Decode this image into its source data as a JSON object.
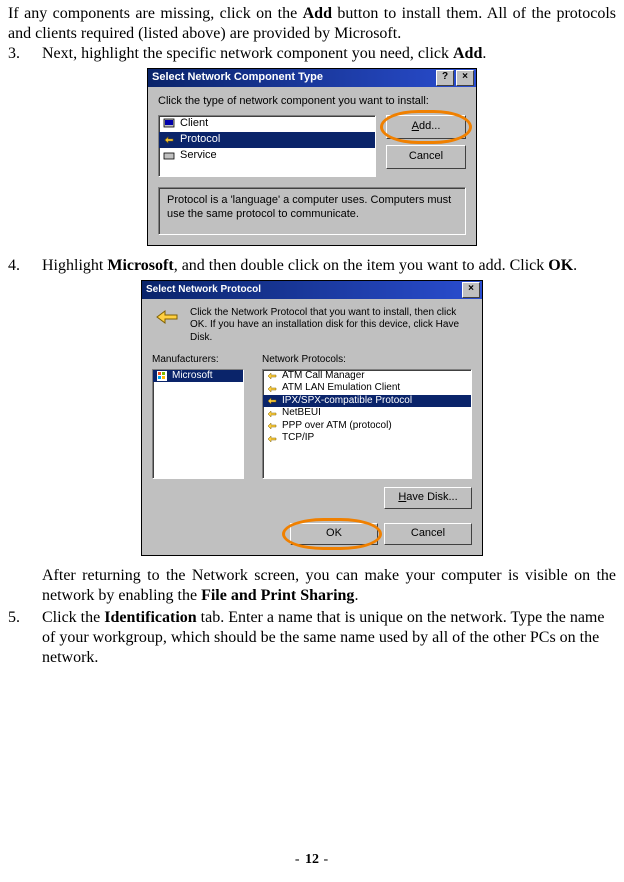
{
  "intro": {
    "para1_a": "If any components are missing, click on the ",
    "para1_add": "Add",
    "para1_b": " button to install them. All of the protocols and clients required (listed above) are provided by Microsoft."
  },
  "step3": {
    "num": "3.",
    "text_a": "Next, highlight the specific network component you need, click ",
    "text_add": "Add",
    "text_b": "."
  },
  "dlg1": {
    "title": "Select Network Component Type",
    "help_glyph": "?",
    "close_glyph": "×",
    "instr": "Click the type of network component you want to install:",
    "items": [
      "Client",
      "Protocol",
      "Service"
    ],
    "selected_index": 1,
    "btn_add": "Add...",
    "btn_cancel": "Cancel",
    "desc": "Protocol is a 'language' a computer uses. Computers must use the same protocol to communicate."
  },
  "step4": {
    "num": "4.",
    "text_a": "Highlight ",
    "text_ms": "Microsoft",
    "text_b": ", and then double click on the item you want to add. Click ",
    "text_ok": "OK",
    "text_c": "."
  },
  "dlg2": {
    "title": "Select Network Protocol",
    "close_glyph": "×",
    "instr": "Click the Network Protocol that you want to install, then click OK. If you have an installation disk for this device, click Have Disk.",
    "mfg_label": "Manufacturers:",
    "proto_label": "Network Protocols:",
    "mfg_items": [
      "Microsoft"
    ],
    "mfg_selected_index": 0,
    "proto_items": [
      "ATM Call Manager",
      "ATM LAN Emulation Client",
      "IPX/SPX-compatible Protocol",
      "NetBEUI",
      "PPP over ATM (protocol)",
      "TCP/IP"
    ],
    "proto_selected_index": 2,
    "btn_havedisk_pre": "H",
    "btn_havedisk_post": "ave Disk...",
    "btn_ok": "OK",
    "btn_cancel": "Cancel"
  },
  "after": {
    "para_a": "After returning to the Network screen, you can make your computer is visible on the network by enabling the ",
    "para_bold": "File and Print Sharing",
    "para_b": "."
  },
  "step5": {
    "num": "5.",
    "text_a": "Click the ",
    "text_ident": "Identification",
    "text_b": " tab. Enter a name that is unique on the network.    Type the name of your workgroup, which should be the same name used by all of the other PCs on the network."
  },
  "page": {
    "dash_l": "- ",
    "num": "12",
    "dash_r": " -"
  },
  "icons": {
    "client": "👤",
    "protocol": "🔌",
    "service": "⚙",
    "net": "🔗"
  }
}
